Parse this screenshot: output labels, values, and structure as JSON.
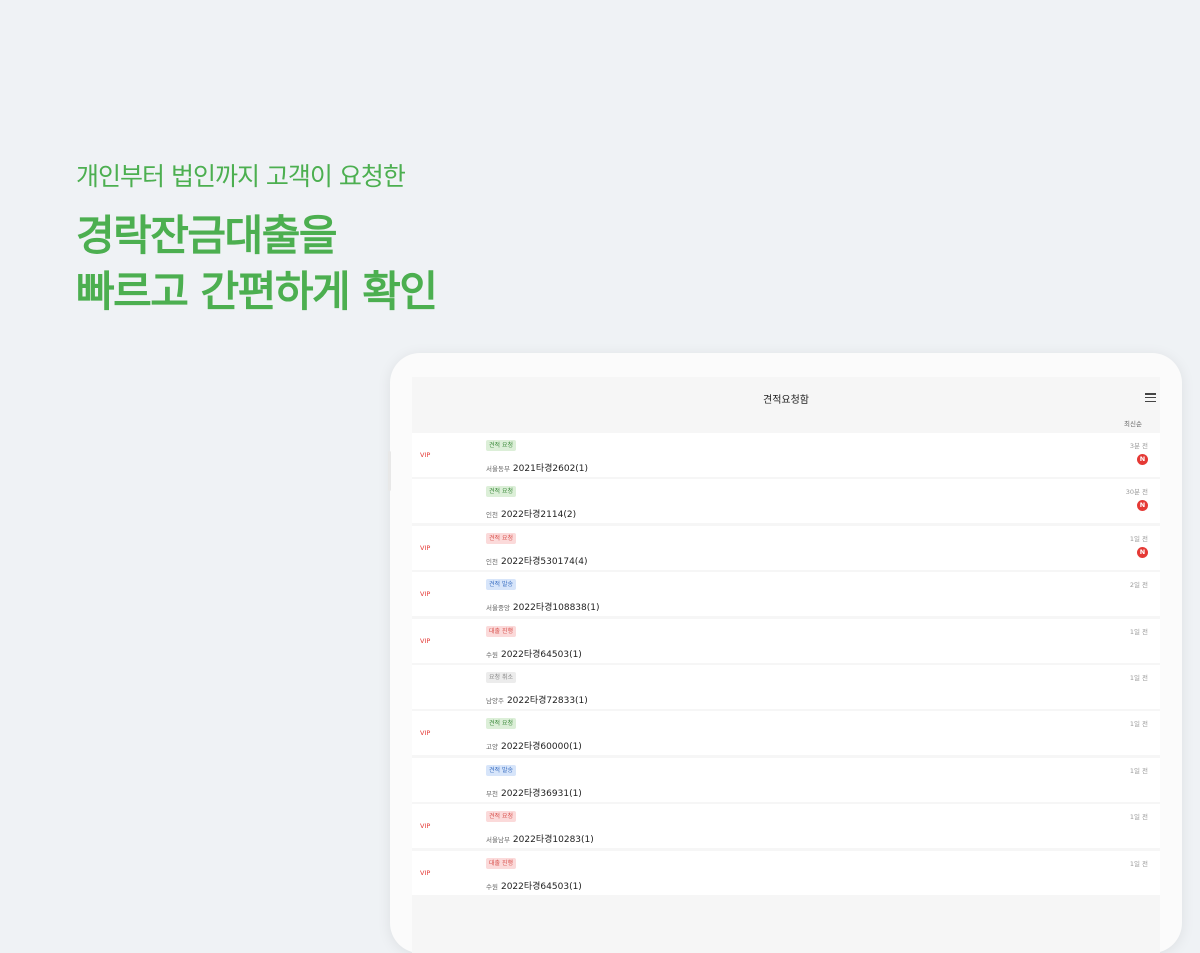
{
  "headline": {
    "subtitle": "개인부터 법인까지 고객이 요청한",
    "title_line1": "경락잔금대출을",
    "title_line2": "빠르고 간편하게 확인"
  },
  "app": {
    "title": "견적요청함",
    "sort_label": "최신순",
    "new_badge_label": "N",
    "vip_label": "VIP"
  },
  "colors": {
    "accent_green": "#4caf50",
    "badge_red": "#e53935",
    "background": "#eff2f5"
  },
  "requests": [
    {
      "vip": true,
      "status": "견적 요청",
      "status_color": "green",
      "court": "서울동부",
      "case_no": "2021타경2602(1)",
      "time": "3분 전",
      "is_new": true
    },
    {
      "vip": false,
      "status": "견적 요청",
      "status_color": "green",
      "court": "인천",
      "case_no": "2022타경2114(2)",
      "time": "30분 전",
      "is_new": true
    },
    {
      "vip": true,
      "status": "견적 요청",
      "status_color": "red",
      "court": "인천",
      "case_no": "2022타경530174(4)",
      "time": "1일 전",
      "is_new": true
    },
    {
      "vip": true,
      "status": "견적 발송",
      "status_color": "blue",
      "court": "서울중앙",
      "case_no": "2022타경108838(1)",
      "time": "2일 전",
      "is_new": false
    },
    {
      "vip": true,
      "status": "대출 진행",
      "status_color": "red",
      "court": "수원",
      "case_no": "2022타경64503(1)",
      "time": "1일 전",
      "is_new": false
    },
    {
      "vip": false,
      "status": "요청 취소",
      "status_color": "gray",
      "court": "남양주",
      "case_no": "2022타경72833(1)",
      "time": "1일 전",
      "is_new": false
    },
    {
      "vip": true,
      "status": "견적 요청",
      "status_color": "green",
      "court": "고양",
      "case_no": "2022타경60000(1)",
      "time": "1일 전",
      "is_new": false
    },
    {
      "vip": false,
      "status": "견적 발송",
      "status_color": "blue",
      "court": "부천",
      "case_no": "2022타경36931(1)",
      "time": "1일 전",
      "is_new": false
    },
    {
      "vip": true,
      "status": "견적 요청",
      "status_color": "red",
      "court": "서울남부",
      "case_no": "2022타경10283(1)",
      "time": "1일 전",
      "is_new": false
    },
    {
      "vip": true,
      "status": "대출 진행",
      "status_color": "red",
      "court": "수원",
      "case_no": "2022타경64503(1)",
      "time": "1일 전",
      "is_new": false
    }
  ]
}
